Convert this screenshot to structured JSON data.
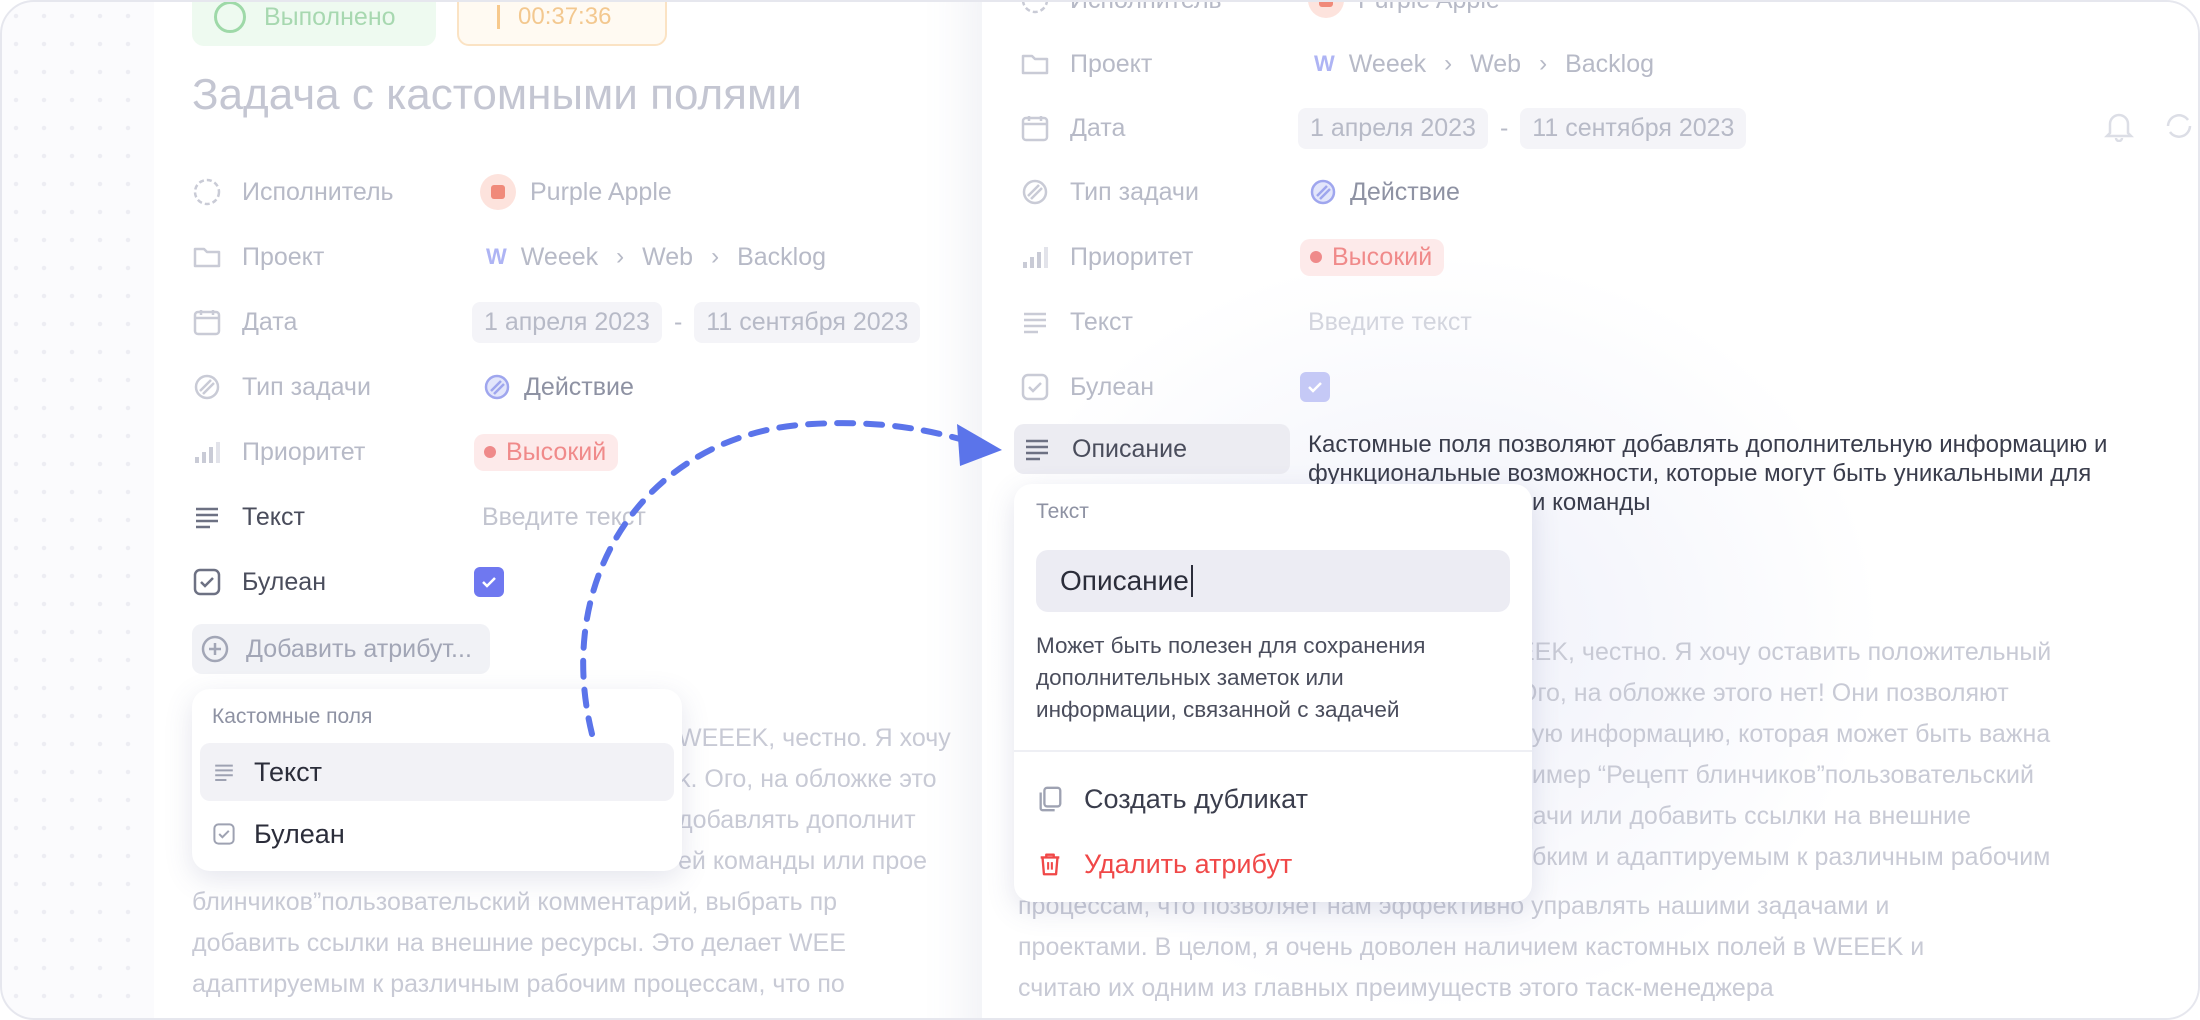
{
  "left": {
    "status_label": "Выполнено",
    "timer": "00:37:36",
    "title": "Задача с кастомными полями",
    "fields": {
      "assignee": {
        "label": "Исполнитель",
        "value": "Purple Apple"
      },
      "project": {
        "label": "Проект",
        "crumbs": [
          "Weeek",
          "Web",
          "Backlog"
        ]
      },
      "date": {
        "label": "Дата",
        "start": "1 апреля 2023",
        "sep": "-",
        "end": "11 сентября 2023"
      },
      "type": {
        "label": "Тип задачи",
        "value": "Действие"
      },
      "priority": {
        "label": "Приоритет",
        "value": "Высокий"
      },
      "text": {
        "label": "Текст",
        "placeholder": "Введите текст"
      },
      "bool": {
        "label": "Булеан",
        "checked": true
      }
    },
    "add_attribute": "Добавить атрибут...",
    "custom_menu": {
      "header": "Кастомные поля",
      "items": [
        "Текст",
        "Булеан"
      ]
    },
    "description_lines": [
      "WEEEK, честно. Я хочу",
      "k. Ого, на обложке это",
      "добавлять дополнит",
      "ей команды или прое",
      "блинчиков”пользовательский комментарий, выбрать пр",
      "добавить ссылки на внешние ресурсы. Это делает WEE",
      "адаптируемым к различным рабочим процессам, что по"
    ]
  },
  "right": {
    "fields": {
      "assignee": {
        "label": "Исполнитель",
        "value": "Purple Apple"
      },
      "project": {
        "label": "Проект",
        "crumbs": [
          "Weeek",
          "Web",
          "Backlog"
        ]
      },
      "date": {
        "label": "Дата",
        "start": "1 апреля 2023",
        "sep": "-",
        "end": "11 сентября 2023"
      },
      "type": {
        "label": "Тип задачи",
        "value": "Действие"
      },
      "priority": {
        "label": "Приоритет",
        "value": "Высокий"
      },
      "text": {
        "label": "Текст",
        "placeholder": "Введите текст"
      },
      "bool": {
        "label": "Булеан",
        "checked": true
      },
      "description": {
        "label": "Описание",
        "value_lines": [
          "Кастомные поля позволяют добавлять дополнительную информацию и",
          "функциональные возможности, которые могут быть уникальными для",
          "ли команды"
        ]
      }
    },
    "popover": {
      "type_label": "Текст",
      "name_value": "Описание",
      "hint": [
        "Может быть полезен для сохранения",
        "дополнительных заметок или",
        "информации, связанной с задачей"
      ],
      "duplicate": "Создать дубликат",
      "delete": "Удалить атрибут"
    },
    "description_lines": [
      "EEK, честно. Я хочу оставить положительный",
      "Ого, на обложке этого нет! Они позволяют",
      "ную информацию, которая может быть важна",
      "ример “Рецепт блинчиков”пользовательский",
      "дачи или добавить ссылки на внешние",
      "ибким и адаптируемым к различным рабочим",
      "процессам, что позволяет нам эффективно управлять нашими задачами и",
      "проектами. В целом, я очень доволен наличием кастомных полей в WEEEK и",
      "считаю их одним из главных преимуществ этого таск-менеджера"
    ]
  },
  "colors": {
    "accent": "#6f78f0",
    "arrow": "#5b74ea",
    "danger": "#f04848",
    "priority_bg": "#fdeaea"
  }
}
